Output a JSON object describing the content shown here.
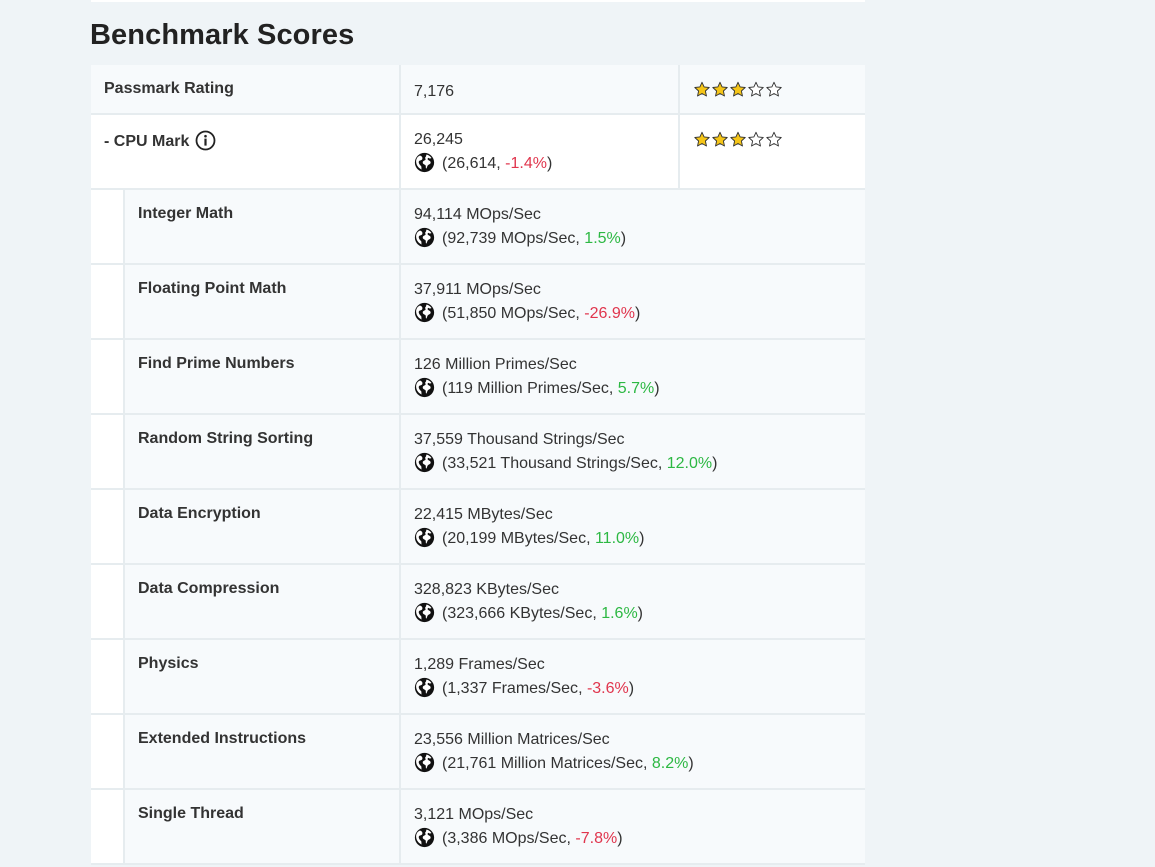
{
  "section_title": "Benchmark Scores",
  "passmark": {
    "label": "Passmark Rating",
    "value": "7,176",
    "stars": 3,
    "max_stars": 5
  },
  "cpu_mark": {
    "label": "- CPU Mark",
    "value": "26,245",
    "avg": "26,614",
    "diff": "-1.4%",
    "diff_sign": "neg",
    "stars": 3,
    "max_stars": 5
  },
  "tests": [
    {
      "label": "Integer Math",
      "value": "94,114 MOps/Sec",
      "avg": "92,739 MOps/Sec",
      "diff": "1.5%",
      "diff_sign": "pos"
    },
    {
      "label": "Floating Point Math",
      "value": "37,911 MOps/Sec",
      "avg": "51,850 MOps/Sec",
      "diff": "-26.9%",
      "diff_sign": "neg"
    },
    {
      "label": "Find Prime Numbers",
      "value": "126 Million Primes/Sec",
      "avg": "119 Million Primes/Sec",
      "diff": "5.7%",
      "diff_sign": "pos"
    },
    {
      "label": "Random String Sorting",
      "value": "37,559 Thousand Strings/Sec",
      "avg": "33,521 Thousand Strings/Sec",
      "diff": "12.0%",
      "diff_sign": "pos"
    },
    {
      "label": "Data Encryption",
      "value": "22,415 MBytes/Sec",
      "avg": "20,199 MBytes/Sec",
      "diff": "11.0%",
      "diff_sign": "pos"
    },
    {
      "label": "Data Compression",
      "value": "328,823 KBytes/Sec",
      "avg": "323,666 KBytes/Sec",
      "diff": "1.6%",
      "diff_sign": "pos"
    },
    {
      "label": "Physics",
      "value": "1,289 Frames/Sec",
      "avg": "1,337 Frames/Sec",
      "diff": "-3.6%",
      "diff_sign": "neg"
    },
    {
      "label": "Extended Instructions",
      "value": "23,556 Million Matrices/Sec",
      "avg": "21,761 Million Matrices/Sec",
      "diff": "8.2%",
      "diff_sign": "pos"
    },
    {
      "label": "Single Thread",
      "value": "3,121 MOps/Sec",
      "avg": "3,386 MOps/Sec",
      "diff": "-7.8%",
      "diff_sign": "neg"
    }
  ],
  "colors": {
    "negative": "#e0354d",
    "positive": "#2db843",
    "star_fill": "#f5c518"
  },
  "icons": {
    "globe": "globe-icon",
    "info": "info-icon",
    "star": "star-icon"
  }
}
